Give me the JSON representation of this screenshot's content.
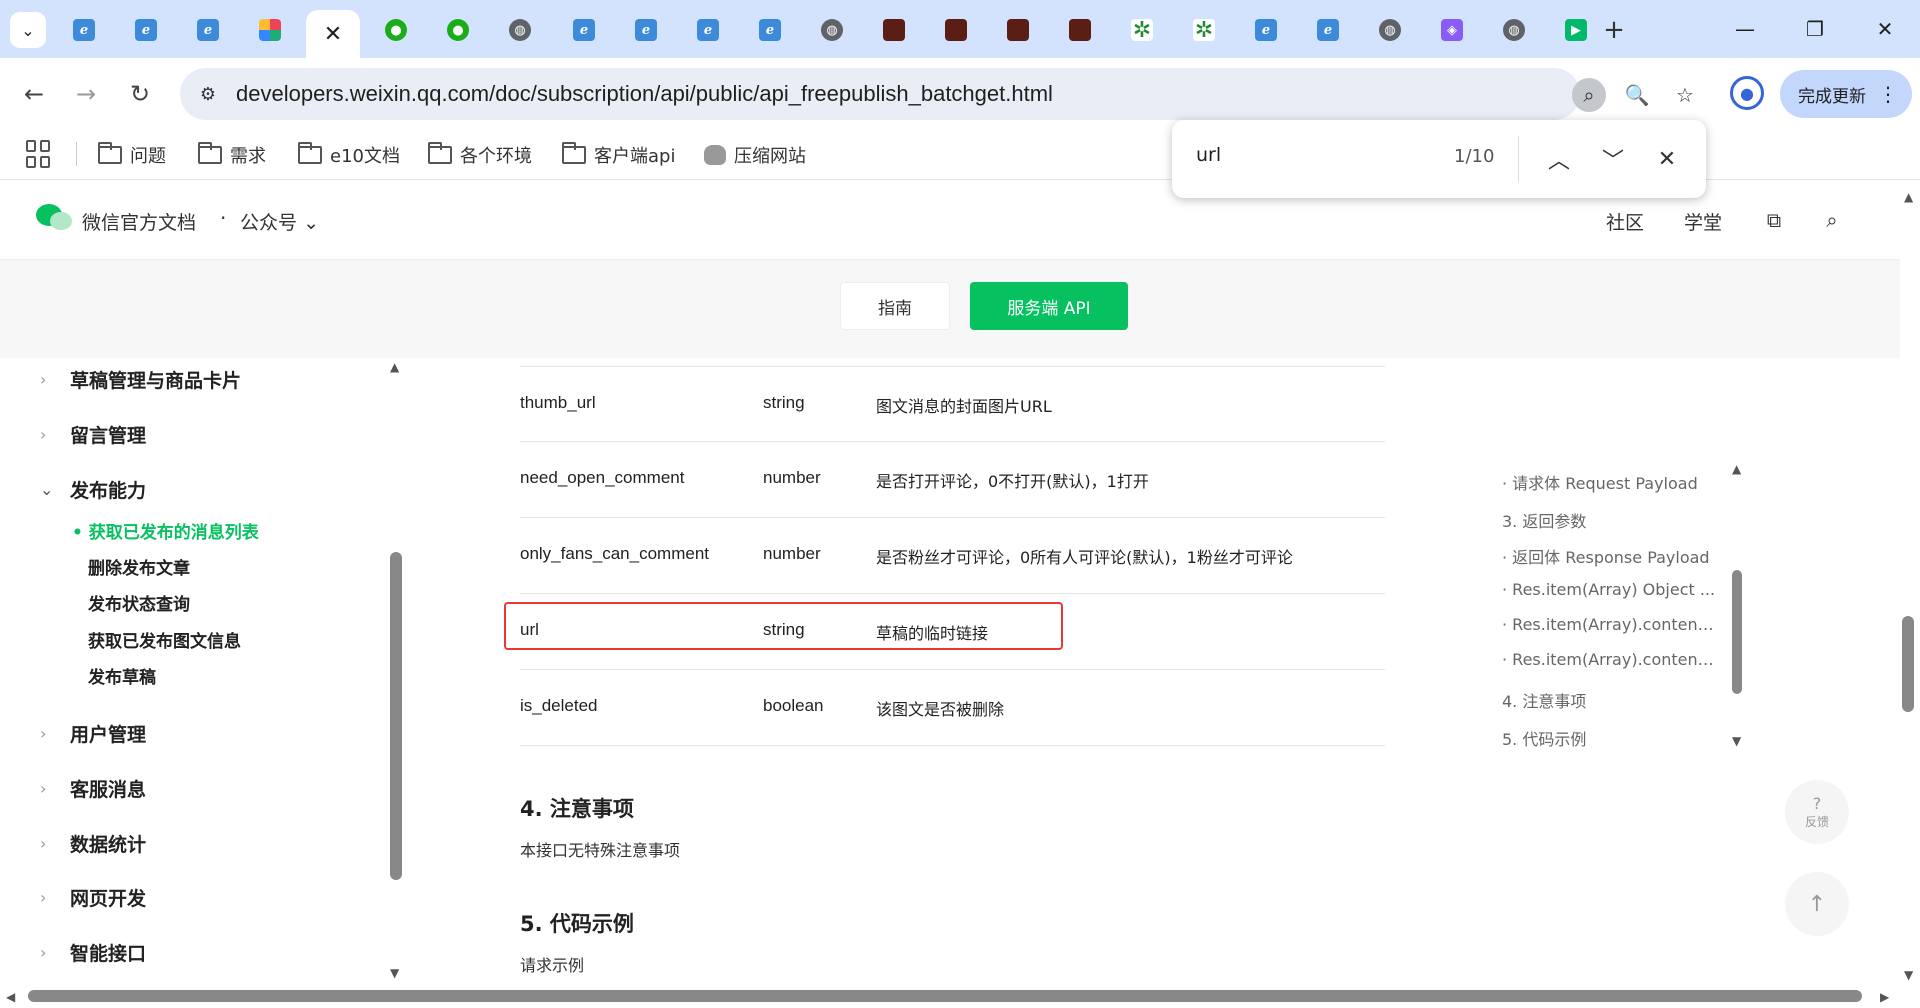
{
  "browser": {
    "tabs": [
      {
        "icon": "ie-icon",
        "glyph": "e"
      },
      {
        "icon": "ie-icon",
        "glyph": "e"
      },
      {
        "icon": "ie-icon",
        "glyph": "e"
      },
      {
        "icon": "grid-app-icon",
        "glyph": ""
      },
      {
        "icon": "close-icon",
        "glyph": "✕",
        "active": true
      },
      {
        "icon": "wechat-icon",
        "glyph": "●"
      },
      {
        "icon": "wechat-icon",
        "glyph": "●"
      },
      {
        "icon": "globe-icon",
        "glyph": "◍"
      },
      {
        "icon": "ie-icon",
        "glyph": "e"
      },
      {
        "icon": "ie-icon",
        "glyph": "e"
      },
      {
        "icon": "ie-icon",
        "glyph": "e"
      },
      {
        "icon": "ie-icon",
        "glyph": "e"
      },
      {
        "icon": "globe-icon",
        "glyph": "◍"
      },
      {
        "icon": "avatar-icon",
        "glyph": ""
      },
      {
        "icon": "avatar-icon",
        "glyph": ""
      },
      {
        "icon": "avatar-icon",
        "glyph": ""
      },
      {
        "icon": "avatar-icon",
        "glyph": ""
      },
      {
        "icon": "green-star-icon",
        "glyph": "✲"
      },
      {
        "icon": "green-star-icon",
        "glyph": "✲"
      },
      {
        "icon": "ie-icon",
        "glyph": "e"
      },
      {
        "icon": "ie-icon",
        "glyph": "e"
      },
      {
        "icon": "globe-icon",
        "glyph": "◍"
      },
      {
        "icon": "purple-app-icon",
        "glyph": "◈"
      },
      {
        "icon": "globe-icon",
        "glyph": "◍"
      },
      {
        "icon": "play-icon",
        "glyph": "▶"
      }
    ],
    "url": "developers.weixin.qq.com/doc/subscription/api/public/api_freepublish_batchget.html",
    "update_label": "完成更新",
    "bookmarks": [
      "问题",
      "需求",
      "e10文档",
      "各个环境",
      "客户端api",
      "压缩网站"
    ],
    "find": {
      "query": "url",
      "count": "1/10"
    }
  },
  "site": {
    "title": "微信官方文档",
    "dot": "·",
    "section": "公众号",
    "links": [
      "社区",
      "学堂"
    ],
    "guide_label": "指南",
    "api_label": "服务端 API"
  },
  "sidebar": {
    "items_top": [
      "草稿管理与商品卡片",
      "留言管理",
      "发布能力"
    ],
    "sub_items": [
      "获取已发布的消息列表",
      "删除发布文章",
      "发布状态查询",
      "获取已发布图文信息",
      "发布草稿"
    ],
    "items_bottom": [
      "用户管理",
      "客服消息",
      "数据统计",
      "网页开发",
      "智能接口"
    ]
  },
  "table": {
    "rows": [
      {
        "name": "thumb_url",
        "type": "string",
        "desc": "图文消息的封面图片URL"
      },
      {
        "name": "need_open_comment",
        "type": "number",
        "desc": "是否打开评论，0不打开(默认)，1打开"
      },
      {
        "name": "only_fans_can_comment",
        "type": "number",
        "desc": "是否粉丝才可评论，0所有人可评论(默认)，1粉丝才可评论"
      },
      {
        "name": "url",
        "type": "string",
        "desc": "草稿的临时链接"
      },
      {
        "name": "is_deleted",
        "type": "boolean",
        "desc": "该图文是否被删除"
      }
    ]
  },
  "sections": {
    "notes_title": "4. 注意事项",
    "notes_text": "本接口无特殊注意事项",
    "code_title": "5. 代码示例",
    "code_text": "请求示例"
  },
  "toc": [
    "· 请求体 Request Payload",
    "3. 返回参数",
    "· 返回体 Response Payload",
    "· Res.item(Array) Object ...",
    "· Res.item(Array).content...",
    "· Res.item(Array).content...",
    "4. 注意事项",
    "5. 代码示例"
  ],
  "feedback": {
    "glyph": "?",
    "label": "反馈"
  }
}
